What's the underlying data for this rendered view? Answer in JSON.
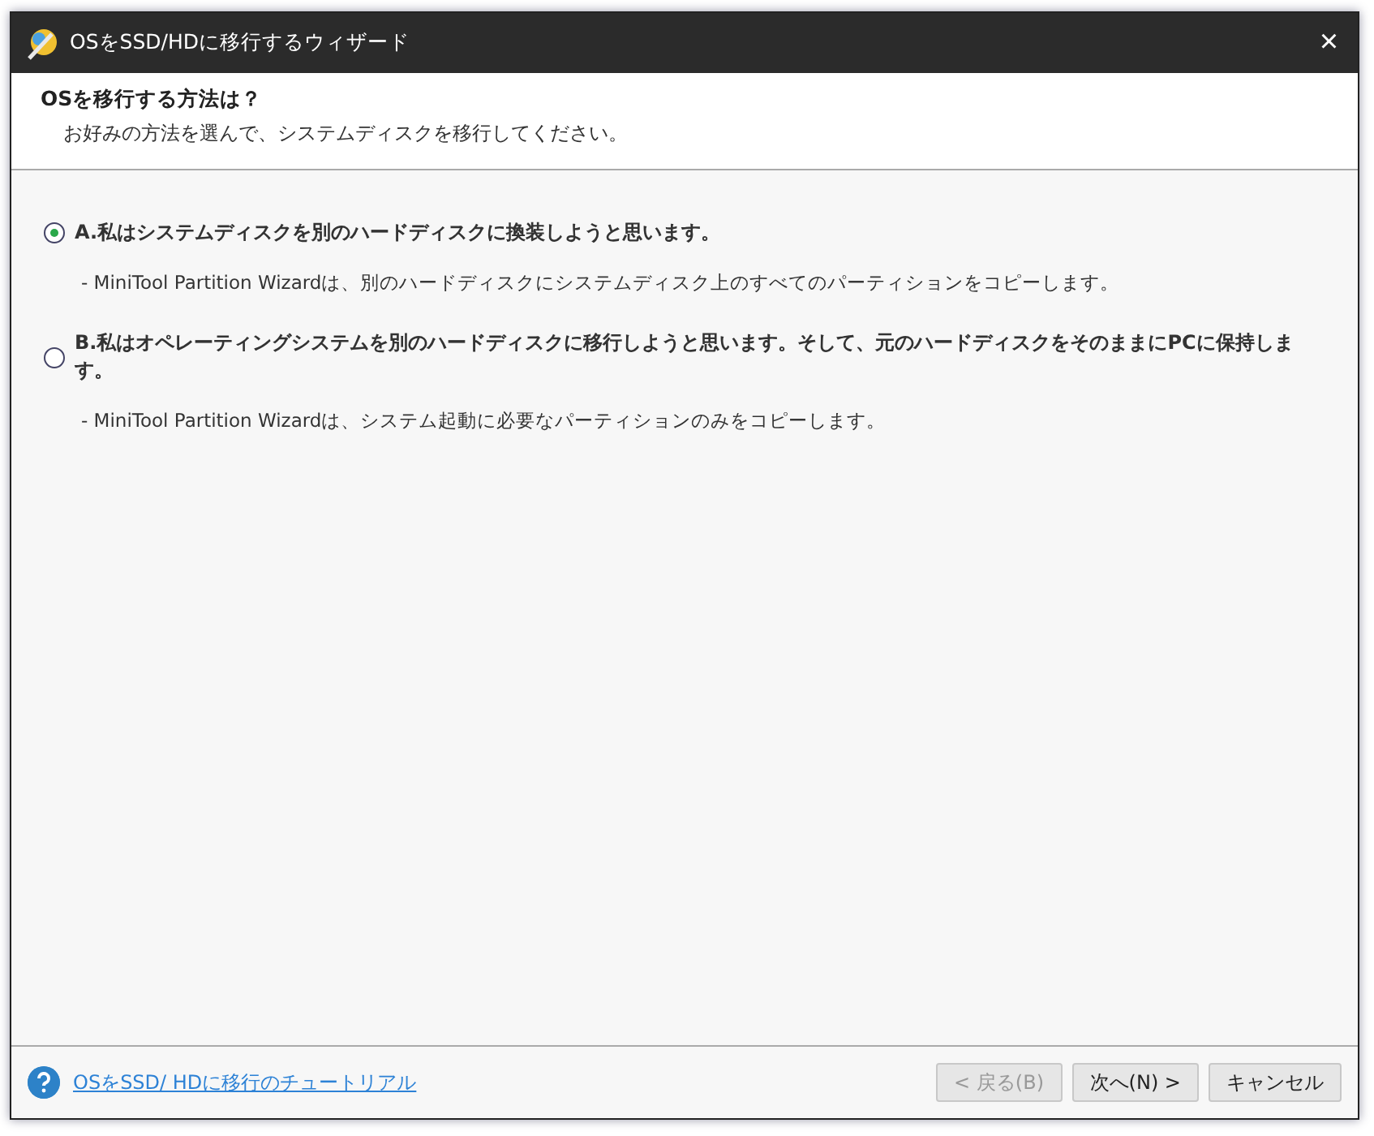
{
  "window": {
    "title": "OSをSSD/HDに移行するウィザード",
    "close": "×"
  },
  "header": {
    "title": "OSを移行する方法は？",
    "subtitle": "お好みの方法を選んで、システムディスクを移行してください。"
  },
  "options": [
    {
      "label": "A.私はシステムディスクを別のハードディスクに換装しようと思います。",
      "description": "- MiniTool Partition Wizardは、別のハードディスクにシステムディスク上のすべてのパーティションをコピーします。",
      "selected": true
    },
    {
      "label": "B.私はオペレーティングシステムを別のハードディスクに移行しようと思います。そして、元のハードディスクをそのままにPCに保持します。",
      "description": "- MiniTool Partition Wizardは、システム起動に必要なパーティションのみをコピーします。",
      "selected": false
    }
  ],
  "footer": {
    "help_link": "OSをSSD/ HDに移行のチュートリアル",
    "buttons": [
      {
        "label": "< 戻る(B)",
        "disabled": true
      },
      {
        "label": "次へ(N) >",
        "disabled": false
      },
      {
        "label": "キャンセル",
        "disabled": false
      }
    ]
  }
}
